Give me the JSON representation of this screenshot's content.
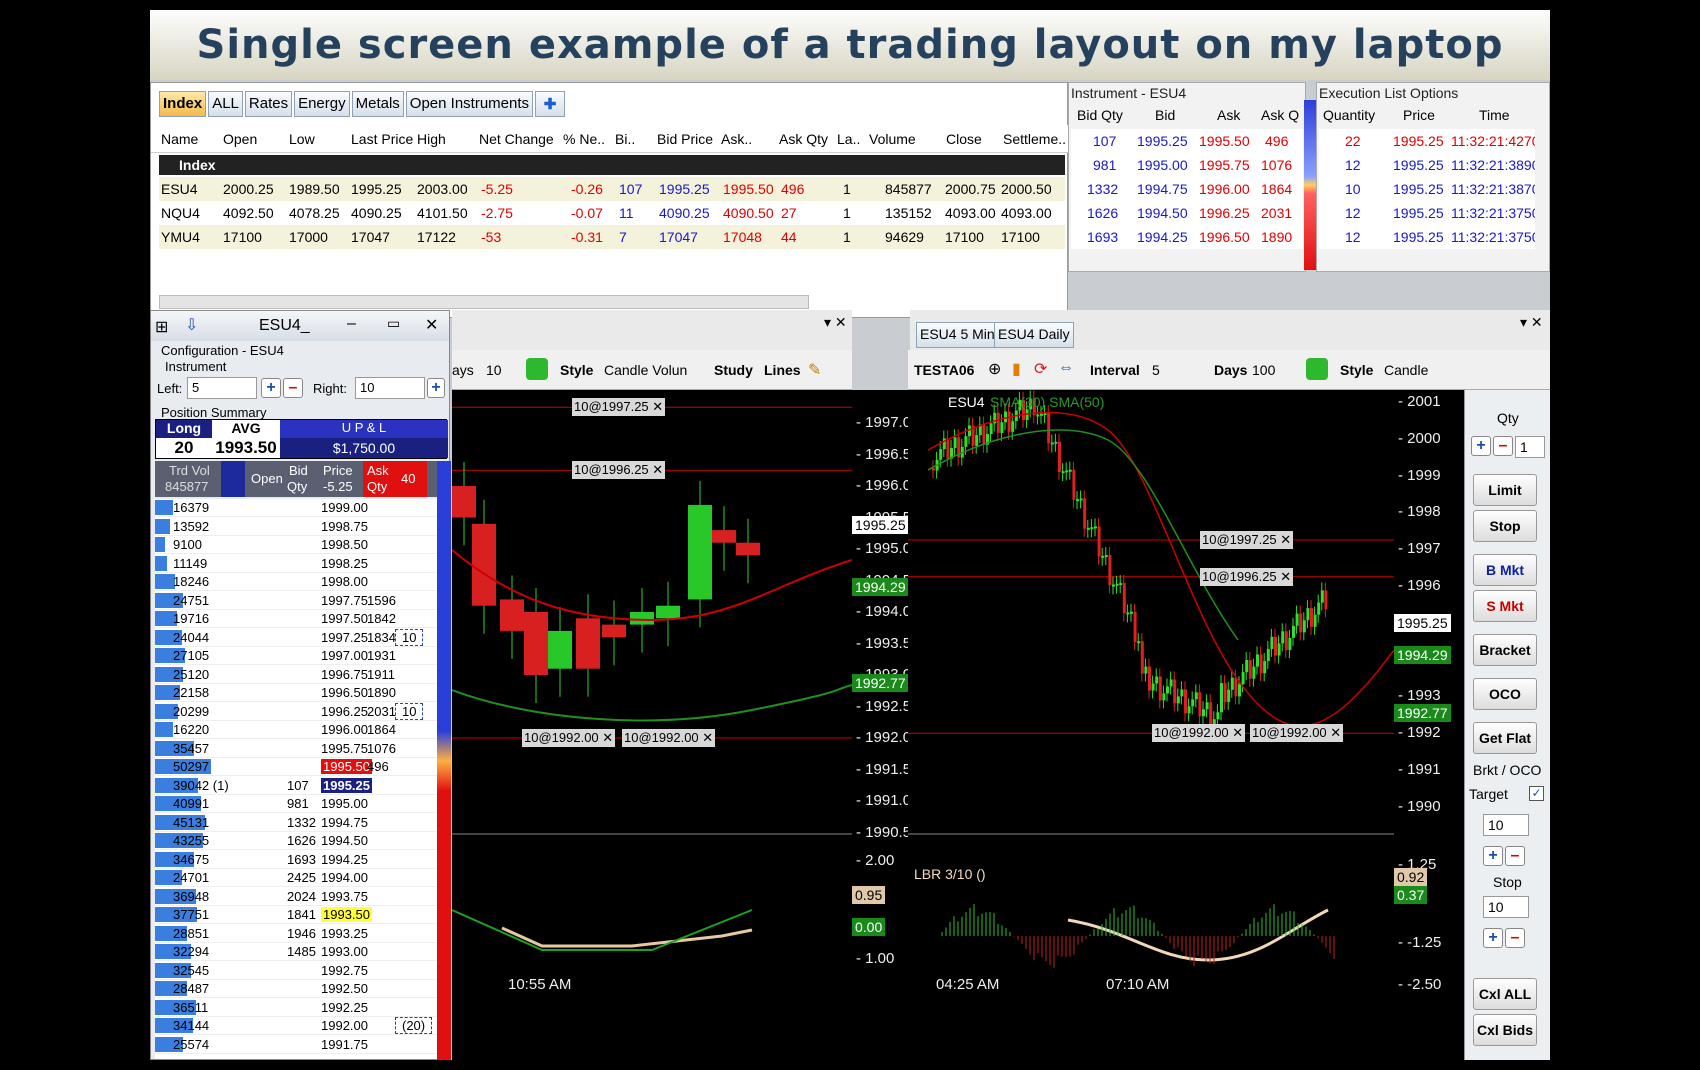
{
  "banner_title": "Single screen example of a trading layout on my laptop",
  "quote_board": {
    "tabs": [
      "Index",
      "ALL",
      "Rates",
      "Energy",
      "Metals",
      "Open Instruments"
    ],
    "columns": [
      "Name",
      "Open",
      "Low",
      "Last Price",
      "High",
      "Net Change",
      "% Ne..",
      "Bi..",
      "Bid Price",
      "Ask..",
      "Ask Qty",
      "La..",
      "Volume",
      "Close",
      "Settleme.."
    ],
    "group": "Index",
    "rows": [
      {
        "name": "ESU4",
        "open": "2000.25",
        "low": "1989.50",
        "last": "1995.25",
        "high": "2003.00",
        "net": "-5.25",
        "pct": "-0.26",
        "bq": "107",
        "bid": "1995.25",
        "ask": "1995.50",
        "askq": "496",
        "la": "1",
        "vol": "845877",
        "close": "2000.75",
        "settle": "2000.50"
      },
      {
        "name": "NQU4",
        "open": "4092.50",
        "low": "4078.25",
        "last": "4090.25",
        "high": "4101.50",
        "net": "-2.75",
        "pct": "-0.07",
        "bq": "11",
        "bid": "4090.25",
        "ask": "4090.50",
        "askq": "27",
        "la": "1",
        "vol": "135152",
        "close": "4093.00",
        "settle": "4093.00"
      },
      {
        "name": "YMU4",
        "open": "17100",
        "low": "17000",
        "last": "17047",
        "high": "17122",
        "net": "-53",
        "pct": "-0.31",
        "bq": "7",
        "bid": "17047",
        "ask": "17048",
        "askq": "44",
        "la": "1",
        "vol": "94629",
        "close": "17100",
        "settle": "17100"
      }
    ]
  },
  "instrument_panel": {
    "title": "Instrument - ESU4",
    "columns": [
      "Bid Qty",
      "Bid",
      "Ask",
      "Ask Q"
    ],
    "rows": [
      [
        "107",
        "1995.25",
        "1995.50",
        "496"
      ],
      [
        "981",
        "1995.00",
        "1995.75",
        "1076"
      ],
      [
        "1332",
        "1994.75",
        "1996.00",
        "1864"
      ],
      [
        "1626",
        "1994.50",
        "1996.25",
        "2031"
      ],
      [
        "1693",
        "1994.25",
        "1996.50",
        "1890"
      ]
    ]
  },
  "execution_panel": {
    "title": "Execution List Options",
    "columns": [
      "Quantity",
      "Price",
      "Time"
    ],
    "rows": [
      [
        "22",
        "1995.25",
        "11:32:21:4270"
      ],
      [
        "12",
        "1995.25",
        "11:32:21:3890"
      ],
      [
        "10",
        "1995.25",
        "11:32:21:3870"
      ],
      [
        "12",
        "1995.25",
        "11:32:21:3750"
      ],
      [
        "12",
        "1995.25",
        "11:32:21:3750"
      ]
    ]
  },
  "dom": {
    "title": "ESU4_",
    "config": "Configuration - ESU4",
    "instrument": "Instrument",
    "left_label": "Left:",
    "left_val": "5",
    "right_label": "Right:",
    "right_val": "10",
    "pos_summary": "Position Summary",
    "long": "Long",
    "avg": "AVG",
    "upl": "U P & L",
    "qty": "20",
    "avgval": "1993.50",
    "uplval": "$1,750.00",
    "headers": {
      "trdvol": "Trd Vol",
      "trdvol_total": "845877",
      "open": "Open",
      "bid": "Bid",
      "bid2": "Qty",
      "price": "Price",
      "price2": "-5.25",
      "ask": "Ask",
      "ask2": "Qty",
      "forty": "40"
    },
    "ladder": [
      [
        "16379",
        "",
        "1999.00",
        ""
      ],
      [
        "13592",
        "",
        "1998.75",
        ""
      ],
      [
        "9100",
        "",
        "1998.50",
        ""
      ],
      [
        "11149",
        "",
        "1998.25",
        ""
      ],
      [
        "18246",
        "",
        "1998.00",
        ""
      ],
      [
        "24751",
        "",
        "1997.75",
        "1596"
      ],
      [
        "19716",
        "",
        "1997.50",
        "1842"
      ],
      [
        "24044",
        "",
        "1997.25",
        "1834"
      ],
      [
        "27105",
        "",
        "1997.00",
        "1931"
      ],
      [
        "25120",
        "",
        "1996.75",
        "1911"
      ],
      [
        "22158",
        "",
        "1996.50",
        "1890"
      ],
      [
        "20299",
        "",
        "1996.25",
        "2031"
      ],
      [
        "16220",
        "",
        "1996.00",
        "1864"
      ],
      [
        "35457",
        "",
        "1995.75",
        "1076"
      ],
      [
        "50297",
        "",
        "1995.50",
        "496"
      ],
      [
        "39042 (1)",
        "107",
        "1995.25",
        ""
      ],
      [
        "40991",
        "981",
        "1995.00",
        ""
      ],
      [
        "45131",
        "1332",
        "1994.75",
        ""
      ],
      [
        "43255",
        "1626",
        "1994.50",
        ""
      ],
      [
        "34675",
        "1693",
        "1994.25",
        ""
      ],
      [
        "24701",
        "2425",
        "1994.00",
        ""
      ],
      [
        "36948",
        "2024",
        "1993.75",
        ""
      ],
      [
        "37751",
        "1841",
        "1993.50",
        ""
      ],
      [
        "28851",
        "1946",
        "1993.25",
        ""
      ],
      [
        "32294",
        "1485",
        "1993.00",
        ""
      ],
      [
        "32545",
        "",
        "1992.75",
        ""
      ],
      [
        "28487",
        "",
        "1992.50",
        ""
      ],
      [
        "36511",
        "",
        "1992.25",
        ""
      ],
      [
        "34144",
        "",
        "1992.00",
        ""
      ],
      [
        "25574",
        "",
        "1991.75",
        ""
      ]
    ],
    "work_orders": [
      "10",
      "10",
      "(20)"
    ]
  },
  "chartA": {
    "toolbar": {
      "days_label": "ays",
      "days_val": "10",
      "style_label": "Style",
      "style_val": "Candle Volun",
      "study": "Study",
      "lines": "Lines"
    },
    "axis": [
      "1997.0",
      "1996.5",
      "1996.0",
      "1995.5",
      "1995.0",
      "1994.5",
      "1994.0",
      "1993.5",
      "1993.0",
      "1992.5",
      "1992.0",
      "1991.5",
      "1991.0",
      "1990.5"
    ],
    "price_last": "1995.25",
    "price_green1": "1994.29",
    "price_green2": "1992.77",
    "orders": [
      "10@1997.25",
      "10@1996.25",
      "10@1992.00",
      "10@1992.00"
    ],
    "lower_axis": [
      "2.00",
      "1.00"
    ],
    "lower_tan": "0.95",
    "lower_green": "0.00",
    "time": "10:55 AM"
  },
  "chartB": {
    "tabs": [
      "ESU4 5 Min",
      "ESU4 Daily"
    ],
    "toolbar": {
      "acct": "TESTA06",
      "interval_label": "Interval",
      "interval_val": "5",
      "days_label": "Days",
      "days_val": "100",
      "style_label": "Style",
      "style_val": "Candle"
    },
    "legend": "ESU4",
    "sma": "SMA(30) SMA(50)",
    "axis": [
      "2001",
      "2000",
      "1999",
      "1998",
      "1997",
      "1996",
      "1995",
      "1994",
      "1993",
      "1992",
      "1991",
      "1990"
    ],
    "price_last": "1995.25",
    "price_green1": "1994.29",
    "price_green2": "1992.77",
    "orders": [
      "10@1997.25",
      "10@1996.25",
      "10@1992.00",
      "10@1992.00"
    ],
    "lbr": "LBR 3/10 ()",
    "lower_axis": [
      "1.25",
      "-1.25",
      "-2.50"
    ],
    "lower_tan": "0.92",
    "lower_green": "0.37",
    "times": [
      "04:25 AM",
      "07:10 AM"
    ]
  },
  "order_panel": {
    "qty_label": "Qty",
    "qty_val": "1",
    "buttons": [
      "Limit",
      "Stop",
      "B Mkt",
      "S Mkt",
      "Bracket",
      "OCO",
      "Get Flat"
    ],
    "brkt": "Brkt / OCO",
    "target": "Target",
    "target_val": "10",
    "stop": "Stop",
    "stop_val": "10",
    "cxl_all": "Cxl ALL",
    "cxl_bids": "Cxl Bids"
  }
}
